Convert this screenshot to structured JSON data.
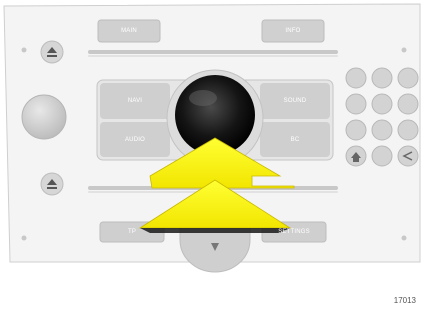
{
  "buttons": {
    "main": "MAIN",
    "info": "INFO",
    "navi": "NAVI",
    "sound": "SOUND",
    "audio": "AUDIO",
    "bc": "BC",
    "tp": "TP",
    "settings": "SETTINGS"
  },
  "figure_id": "17013",
  "colors": {
    "arrow": "#ffff00",
    "panel": "#f2f2f2",
    "button": "#d0d0d0",
    "knob": "#111111"
  }
}
